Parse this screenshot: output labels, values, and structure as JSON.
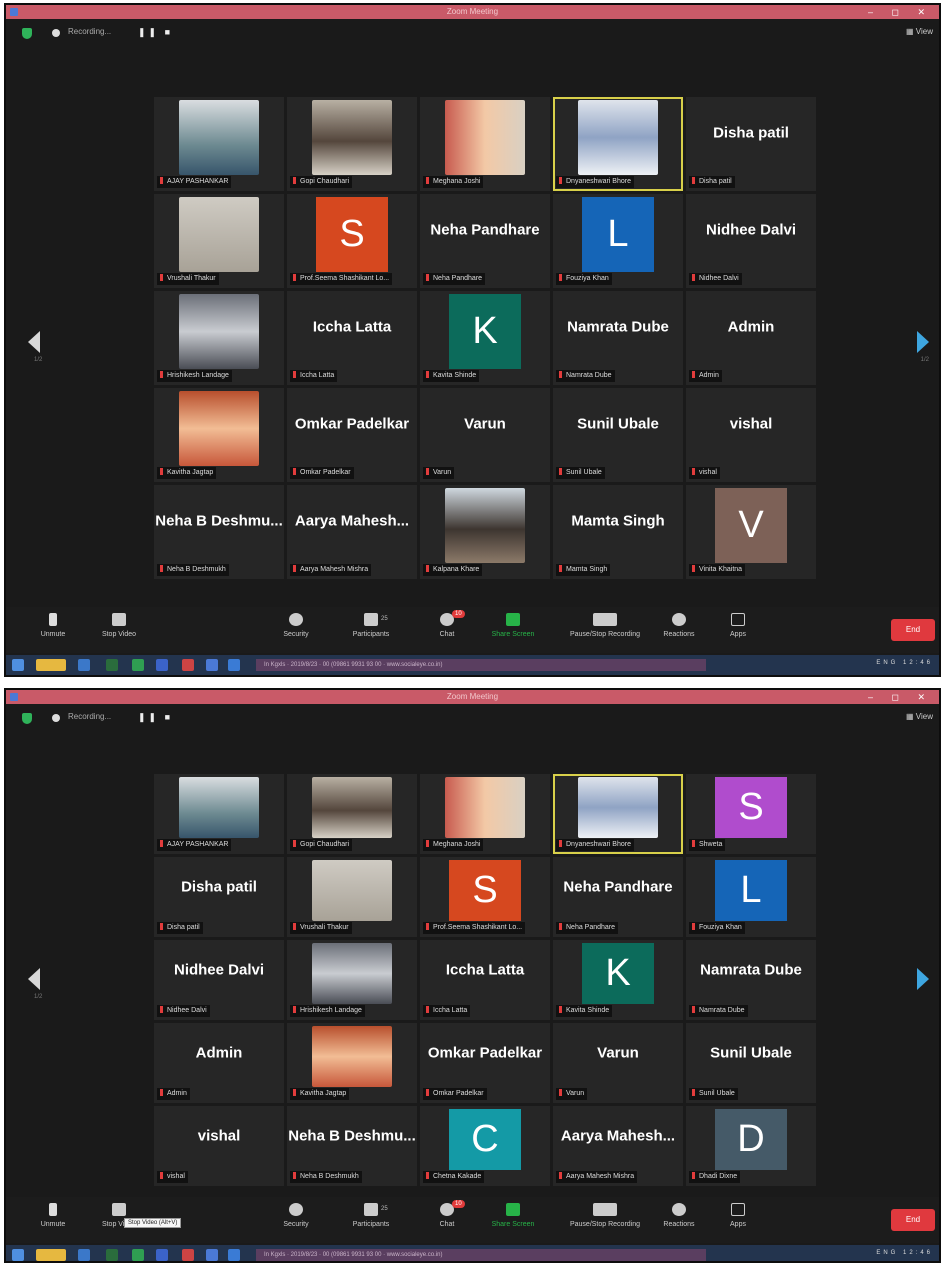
{
  "app": {
    "title": "Zoom Meeting",
    "view_label": "View"
  },
  "recording": {
    "label": "Recording...",
    "controls": "❚❚ ■"
  },
  "toolbar": {
    "unmute": "Unmute",
    "stop_video": "Stop Video",
    "security": "Security",
    "participants": "Participants",
    "participants_count": "25",
    "chat": "Chat",
    "chat_badge": "10",
    "share_screen": "Share Screen",
    "pause_recording": "Pause/Stop Recording",
    "reactions": "Reactions",
    "apps": "Apps",
    "end": "End",
    "stop_video_tooltip": "Stop Video (Alt+V)"
  },
  "pager": {
    "left": "1/2",
    "right": "1/2"
  },
  "taskbar": {
    "center_text": "In Kgxls  ·  2019/8/23  ·  00   (09861 9931 93 00 · www.socialeye.co.in)",
    "clock": "ENG  12:46"
  },
  "colors": {
    "accent_green": "#27b348",
    "end_red": "#e0393e",
    "active_border": "#d8d04a",
    "record_red": "#e13b3b"
  },
  "shot1": {
    "tiles": [
      {
        "type": "video",
        "caption": "AJAY PASHANKAR",
        "bg": "linear-gradient(#d9dde0,#6d8a91 60%,#37556b)"
      },
      {
        "type": "video",
        "caption": "Gopi Chaudhari",
        "bg": "linear-gradient(#b8b0a3,#54463c 55%,#d7d1c6)"
      },
      {
        "type": "video",
        "caption": "Meghana Joshi",
        "bg": "linear-gradient(90deg,#c85b4f,#f3c9a6 50%,#d9d0c3)"
      },
      {
        "type": "video",
        "caption": "Dnyaneshwari Bhore",
        "bg": "linear-gradient(#dfe4ec,#8fa3c4 50%,#eef1f5)",
        "active": true
      },
      {
        "type": "name",
        "name": "Disha patil",
        "caption": "Disha patil"
      },
      {
        "type": "video",
        "caption": "Vrushali Thakur",
        "bg": "linear-gradient(#cfcbc3,#a8a297)"
      },
      {
        "type": "avatar",
        "letter": "S",
        "color": "#d6481f",
        "caption": "Prof.Seema Shashikant Lo..."
      },
      {
        "type": "name",
        "name": "Neha Pandhare",
        "caption": "Neha Pandhare"
      },
      {
        "type": "avatar",
        "letter": "L",
        "color": "#1565b7",
        "caption": "Fouziya Khan"
      },
      {
        "type": "name",
        "name": "Nidhee Dalvi",
        "caption": "Nidhee Dalvi"
      },
      {
        "type": "video",
        "caption": "Hrishikesh Landage",
        "bg": "linear-gradient(#6b6f78,#c9ccd1 50%,#4a4d55)"
      },
      {
        "type": "name",
        "name": "Iccha Latta",
        "caption": "Iccha Latta"
      },
      {
        "type": "avatar",
        "letter": "K",
        "color": "#0c6b5b",
        "caption": "Kavita Shinde"
      },
      {
        "type": "name",
        "name": "Namrata Dube",
        "caption": "Namrata Dube"
      },
      {
        "type": "name",
        "name": "Admin",
        "caption": "Admin"
      },
      {
        "type": "video",
        "caption": "Kavitha Jagtap",
        "bg": "linear-gradient(#b84f2d,#f2bd95 50%,#c7573a)"
      },
      {
        "type": "name",
        "name": "Omkar Padelkar",
        "caption": "Omkar Padelkar"
      },
      {
        "type": "name",
        "name": "Varun",
        "caption": "Varun"
      },
      {
        "type": "name",
        "name": "Sunil Ubale",
        "caption": "Sunil Ubale"
      },
      {
        "type": "name",
        "name": "vishal",
        "caption": "vishal"
      },
      {
        "type": "name",
        "name": "Neha B Deshmu...",
        "caption": "Neha B Deshmukh"
      },
      {
        "type": "name",
        "name": "Aarya Mahesh...",
        "caption": "Aarya Mahesh Mishra"
      },
      {
        "type": "video",
        "caption": "Kalpana Khare",
        "bg": "linear-gradient(#cfd8df,#3d3530 55%,#8c7a69)"
      },
      {
        "type": "name",
        "name": "Mamta Singh",
        "caption": "Mamta Singh"
      },
      {
        "type": "avatar",
        "letter": "V",
        "color": "#7d6157",
        "caption": "Vinita Khaitna"
      }
    ]
  },
  "shot2": {
    "tiles": [
      {
        "type": "video",
        "caption": "AJAY PASHANKAR",
        "bg": "linear-gradient(#d9dde0,#6d8a91 60%,#37556b)"
      },
      {
        "type": "video",
        "caption": "Gopi Chaudhari",
        "bg": "linear-gradient(#b8b0a3,#54463c 55%,#d7d1c6)"
      },
      {
        "type": "video",
        "caption": "Meghana Joshi",
        "bg": "linear-gradient(90deg,#c85b4f,#f3c9a6 50%,#d9d0c3)"
      },
      {
        "type": "video",
        "caption": "Dnyaneshwari Bhore",
        "bg": "linear-gradient(#dfe4ec,#8fa3c4 50%,#eef1f5)",
        "active": true
      },
      {
        "type": "avatar",
        "letter": "S",
        "color": "#b04ccd",
        "caption": "Shweta"
      },
      {
        "type": "name",
        "name": "Disha patil",
        "caption": "Disha patil"
      },
      {
        "type": "video",
        "caption": "Vrushali Thakur",
        "bg": "linear-gradient(#cfcbc3,#a8a297)"
      },
      {
        "type": "avatar",
        "letter": "S",
        "color": "#d6481f",
        "caption": "Prof.Seema Shashikant Lo..."
      },
      {
        "type": "name",
        "name": "Neha Pandhare",
        "caption": "Neha Pandhare"
      },
      {
        "type": "avatar",
        "letter": "L",
        "color": "#1565b7",
        "caption": "Fouziya Khan"
      },
      {
        "type": "name",
        "name": "Nidhee Dalvi",
        "caption": "Nidhee Dalvi"
      },
      {
        "type": "video",
        "caption": "Hrishikesh Landage",
        "bg": "linear-gradient(#6b6f78,#c9ccd1 50%,#4a4d55)"
      },
      {
        "type": "name",
        "name": "Iccha Latta",
        "caption": "Iccha Latta"
      },
      {
        "type": "avatar",
        "letter": "K",
        "color": "#0c6b5b",
        "caption": "Kavita Shinde"
      },
      {
        "type": "name",
        "name": "Namrata Dube",
        "caption": "Namrata Dube"
      },
      {
        "type": "name",
        "name": "Admin",
        "caption": "Admin"
      },
      {
        "type": "video",
        "caption": "Kavitha Jagtap",
        "bg": "linear-gradient(#b84f2d,#f2bd95 50%,#c7573a)"
      },
      {
        "type": "name",
        "name": "Omkar Padelkar",
        "caption": "Omkar Padelkar"
      },
      {
        "type": "name",
        "name": "Varun",
        "caption": "Varun"
      },
      {
        "type": "name",
        "name": "Sunil Ubale",
        "caption": "Sunil Ubale"
      },
      {
        "type": "name",
        "name": "vishal",
        "caption": "vishal"
      },
      {
        "type": "name",
        "name": "Neha B Deshmu...",
        "caption": "Neha B Deshmukh"
      },
      {
        "type": "avatar",
        "letter": "C",
        "color": "#149aa6",
        "caption": "Chetna Kakade"
      },
      {
        "type": "name",
        "name": "Aarya Mahesh...",
        "caption": "Aarya Mahesh Mishra"
      },
      {
        "type": "avatar",
        "letter": "D",
        "color": "#455a68",
        "caption": "Dhadi Dixne"
      }
    ]
  }
}
